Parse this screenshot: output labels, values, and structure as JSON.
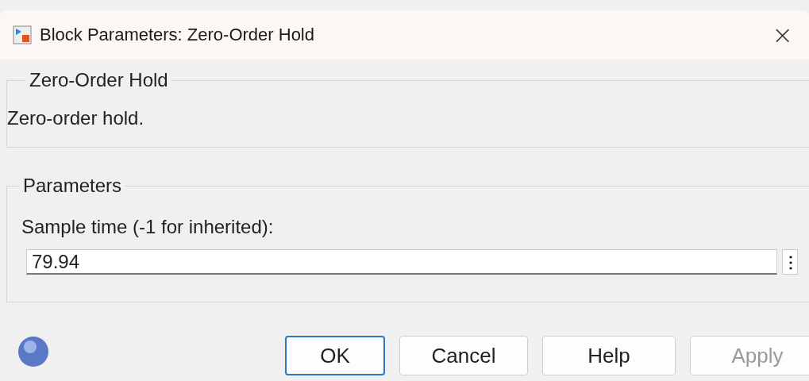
{
  "window": {
    "title": "Block Parameters: Zero-Order Hold",
    "close": "×"
  },
  "description_group": {
    "title": "Zero-Order Hold",
    "text": "Zero-order hold."
  },
  "parameters_group": {
    "title": "Parameters",
    "fields": [
      {
        "label": "Sample time (-1 for inherited):",
        "value": "79.94",
        "menu": "⋮"
      }
    ]
  },
  "buttons": [
    {
      "label": "OK",
      "default": true,
      "disabled": false
    },
    {
      "label": "Cancel",
      "default": false,
      "disabled": false
    },
    {
      "label": "Help",
      "default": false,
      "disabled": false
    },
    {
      "label": "Apply",
      "default": false,
      "disabled": true
    }
  ]
}
